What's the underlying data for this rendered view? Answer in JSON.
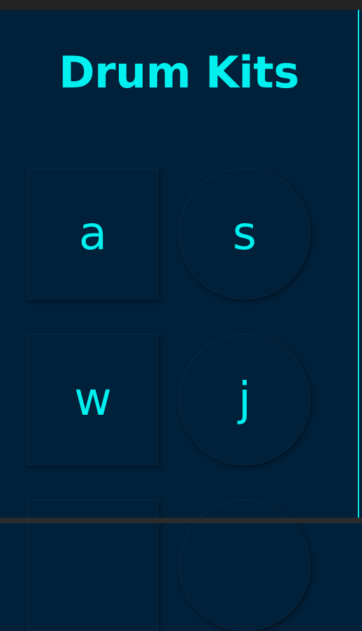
{
  "app": {
    "title": "Drum Kits"
  },
  "pads": [
    {
      "key": "a",
      "shape": "square"
    },
    {
      "key": "s",
      "shape": "circle"
    },
    {
      "key": "w",
      "shape": "square"
    },
    {
      "key": "j",
      "shape": "circle"
    },
    {
      "key": "",
      "shape": "square"
    },
    {
      "key": "",
      "shape": "circle"
    }
  ],
  "colors": {
    "background": "#012039",
    "accent": "#00f0f0",
    "divider": "#0ae6e6"
  }
}
